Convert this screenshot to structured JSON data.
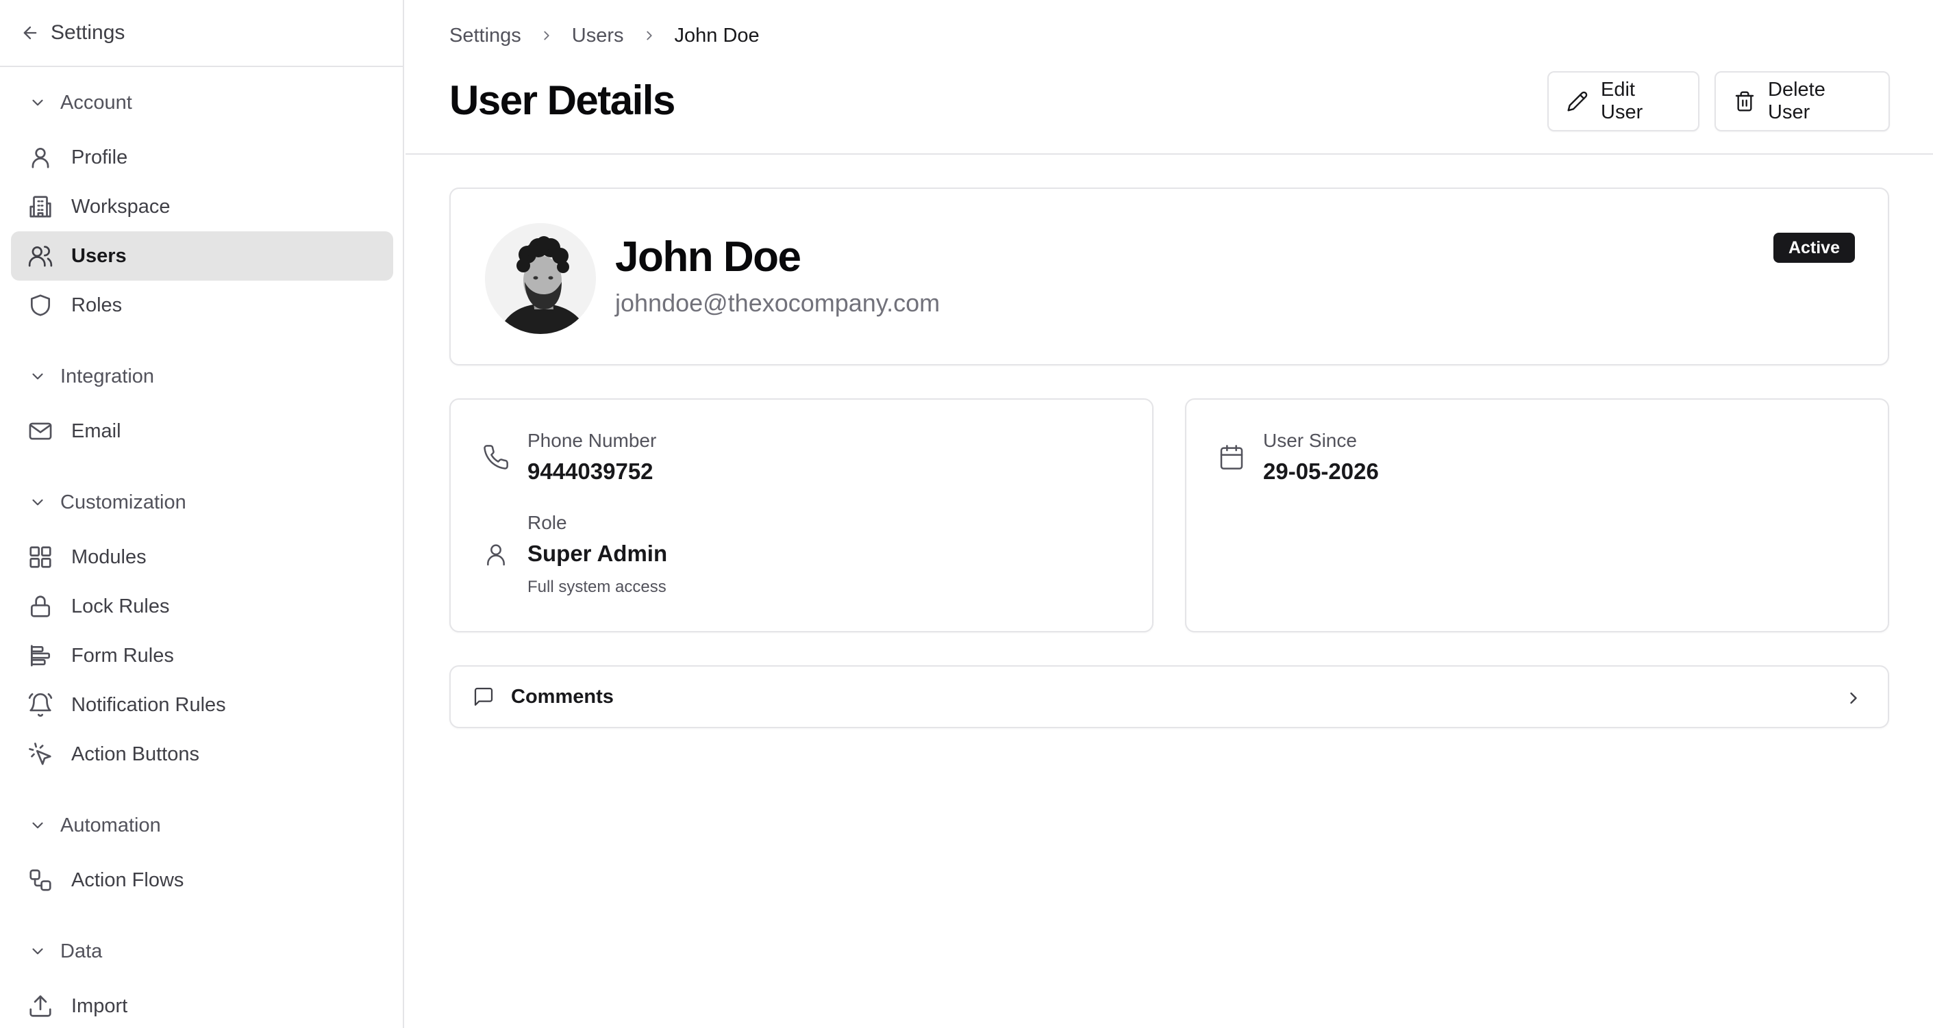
{
  "sidebar": {
    "title": "Settings",
    "groups": [
      {
        "label": "Account",
        "items": [
          {
            "label": "Profile",
            "icon": "user-icon"
          },
          {
            "label": "Workspace",
            "icon": "building-icon"
          },
          {
            "label": "Users",
            "icon": "users-icon",
            "active": true
          },
          {
            "label": "Roles",
            "icon": "shield-icon"
          }
        ]
      },
      {
        "label": "Integration",
        "items": [
          {
            "label": "Email",
            "icon": "mail-icon"
          }
        ]
      },
      {
        "label": "Customization",
        "items": [
          {
            "label": "Modules",
            "icon": "grid-icon"
          },
          {
            "label": "Lock Rules",
            "icon": "lock-icon"
          },
          {
            "label": "Form Rules",
            "icon": "form-icon"
          },
          {
            "label": "Notification Rules",
            "icon": "bell-icon"
          },
          {
            "label": "Action Buttons",
            "icon": "cursor-click-icon"
          }
        ]
      },
      {
        "label": "Automation",
        "items": [
          {
            "label": "Action Flows",
            "icon": "workflow-icon"
          }
        ]
      },
      {
        "label": "Data",
        "items": [
          {
            "label": "Import",
            "icon": "upload-icon"
          }
        ]
      }
    ]
  },
  "breadcrumb": [
    "Settings",
    "Users",
    "John Doe"
  ],
  "page": {
    "title": "User Details",
    "edit_label": "Edit User",
    "delete_label": "Delete User"
  },
  "user": {
    "name": "John Doe",
    "email": "johndoe@thexocompany.com",
    "status": "Active",
    "phone_label": "Phone Number",
    "phone": "9444039752",
    "role_label": "Role",
    "role": "Super Admin",
    "role_desc": "Full system access",
    "since_label": "User Since",
    "since": "29-05-2026"
  },
  "comments": {
    "label": "Comments"
  },
  "colors": {
    "active_bg": "#e4e4e4",
    "badge_bg": "#18181b",
    "border": "#e4e4e7"
  }
}
